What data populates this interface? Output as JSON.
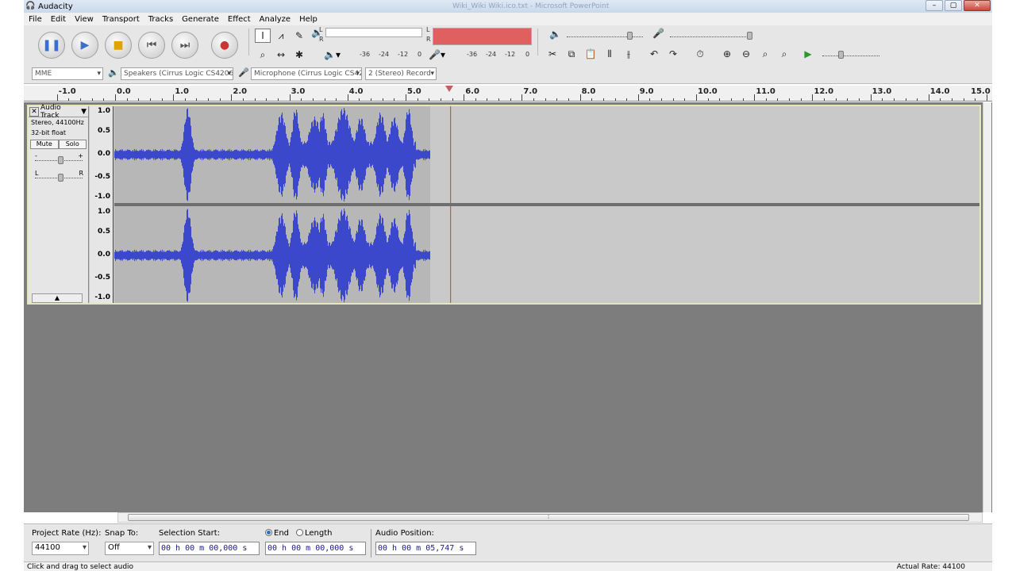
{
  "window": {
    "title": "Audacity",
    "faded_title": "Wiki_Wiki Wiki.ico.txt - Microsoft PowerPoint"
  },
  "menu": [
    "File",
    "Edit",
    "View",
    "Transport",
    "Tracks",
    "Generate",
    "Effect",
    "Analyze",
    "Help"
  ],
  "meters": {
    "playback_labels": [
      "L",
      "R"
    ],
    "playback_ticks": [
      "-36",
      "-24",
      "-12",
      "0"
    ],
    "record_labels": [
      "L",
      "R"
    ],
    "record_ticks": [
      "-36",
      "-24",
      "-12",
      "0"
    ],
    "record_level_color": "#e06060"
  },
  "devices": {
    "host": "MME",
    "output": "Speakers (Cirrus Logic CS4206",
    "input": "Microphone (Cirrus Logic CS42",
    "channels": "2 (Stereo) Record"
  },
  "ruler": {
    "ticks": [
      "-1.0",
      "0.0",
      "1.0",
      "2.0",
      "3.0",
      "4.0",
      "5.0",
      "6.0",
      "7.0",
      "8.0",
      "9.0",
      "10.0",
      "11.0",
      "12.0",
      "13.0",
      "14.0",
      "15.0"
    ]
  },
  "track": {
    "name": "Audio Track",
    "format": "Stereo, 44100Hz",
    "bit_depth": "32-bit float",
    "mute_label": "Mute",
    "solo_label": "Solo",
    "gain_left": "-",
    "gain_right": "+",
    "pan_left": "L",
    "pan_right": "R",
    "scale": [
      "1.0",
      "0.5",
      "0.0",
      "-0.5",
      "-1.0"
    ],
    "wave_color": "#3c48cc",
    "cursor_seconds": 5.747
  },
  "selection": {
    "project_rate_label": "Project Rate (Hz):",
    "project_rate": "44100",
    "snap_label": "Snap To:",
    "snap_value": "Off",
    "start_label": "Selection Start:",
    "start_value": "00 h 00 m 00,000 s",
    "end_label": "End",
    "length_label": "Length",
    "end_value": "00 h 00 m 00,000 s",
    "position_label": "Audio Position:",
    "position_value": "00 h 00 m 05,747 s"
  },
  "status": {
    "left": "Click and drag to select audio",
    "right": "Actual Rate: 44100"
  }
}
